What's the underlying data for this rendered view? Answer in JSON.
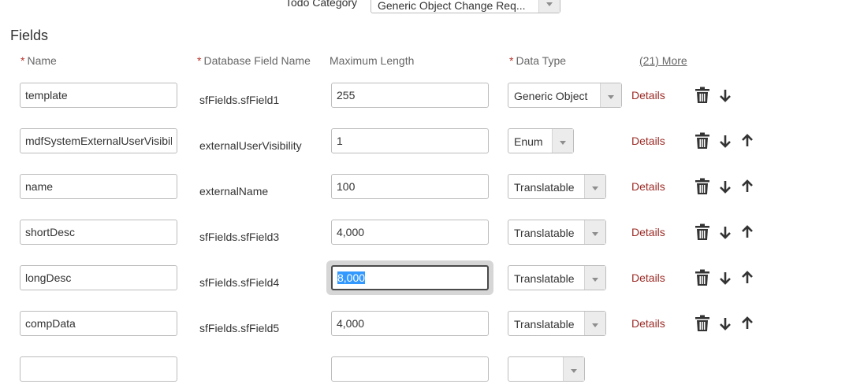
{
  "header": {
    "todo_category_label": "Todo Category",
    "todo_category_value": "Generic Object Change Req..."
  },
  "section_title": "Fields",
  "columns": {
    "name": "Name",
    "db_field": "Database Field Name",
    "max_length": "Maximum Length",
    "data_type": "Data Type",
    "more": "(21) More",
    "required_marker": "*"
  },
  "rows": [
    {
      "name": "template",
      "db_field": "sfFields.sfField1",
      "max_length": "255",
      "data_type": "Generic Object",
      "details": "Details"
    },
    {
      "name": "mdfSystemExternalUserVisibility",
      "db_field": "externalUserVisibility",
      "max_length": "1",
      "data_type": "Enum",
      "details": "Details"
    },
    {
      "name": "name",
      "db_field": "externalName",
      "max_length": "100",
      "data_type": "Translatable",
      "details": "Details"
    },
    {
      "name": "shortDesc",
      "db_field": "sfFields.sfField3",
      "max_length": "4,000",
      "data_type": "Translatable",
      "details": "Details"
    },
    {
      "name": "longDesc",
      "db_field": "sfFields.sfField4",
      "max_length": "8,000",
      "data_type": "Translatable",
      "details": "Details"
    },
    {
      "name": "compData",
      "db_field": "sfFields.sfField5",
      "max_length": "4,000",
      "data_type": "Translatable",
      "details": "Details"
    }
  ],
  "icons": {
    "delete": "trash-icon",
    "move_down": "arrow-down-icon",
    "move_up": "arrow-up-icon",
    "dropdown": "chevron-down-icon"
  },
  "colors": {
    "required": "#b8332b",
    "link": "#9b2b26",
    "text": "#333333",
    "selection": "#3399ff"
  }
}
